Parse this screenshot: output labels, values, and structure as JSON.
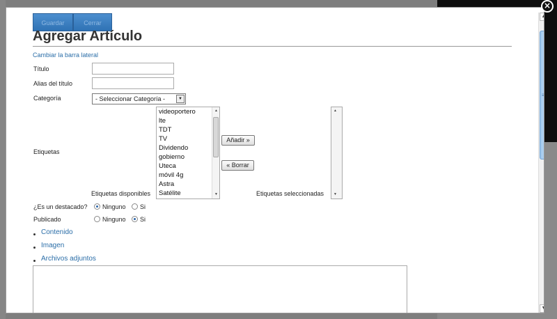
{
  "toolbar": {
    "save_label": "Guardar",
    "cancel_label": "Cerrar"
  },
  "page_title": "Agregar Artículo",
  "sidebar_link": "Cambiar la barra lateral",
  "form": {
    "title_label": "Título",
    "alias_label": "Alias del título",
    "category_label": "Categoría",
    "category_value": "- Seleccionar Categoría -",
    "tags_label": "Etiquetas",
    "available_tags_label": "Etiquetas disponibles",
    "selected_tags_label": "Etiquetas seleccionadas",
    "available_tags": [
      "videoportero",
      "lte",
      "TDT",
      "TV",
      "Dividendo",
      "gobierno",
      "Uteca",
      "móvil 4g",
      "Astra",
      "Satélite"
    ],
    "add_button": "Añadir »",
    "remove_button": "« Borrar",
    "featured_label": "¿Es un destacado?",
    "featured_options": [
      "Ninguno",
      "Si"
    ],
    "featured_selected": "Ninguno",
    "published_label": "Publicado",
    "published_options": [
      "Ninguno",
      "Si"
    ],
    "published_selected": "Si"
  },
  "sections": [
    "Contenido",
    "Imagen",
    "Archivos adjuntos"
  ],
  "icons": {
    "close": "close-icon",
    "dropdown": "chevron-down-icon"
  },
  "colors": {
    "accent": "#2b6ea8",
    "button_blue": "#3a7dbf"
  }
}
